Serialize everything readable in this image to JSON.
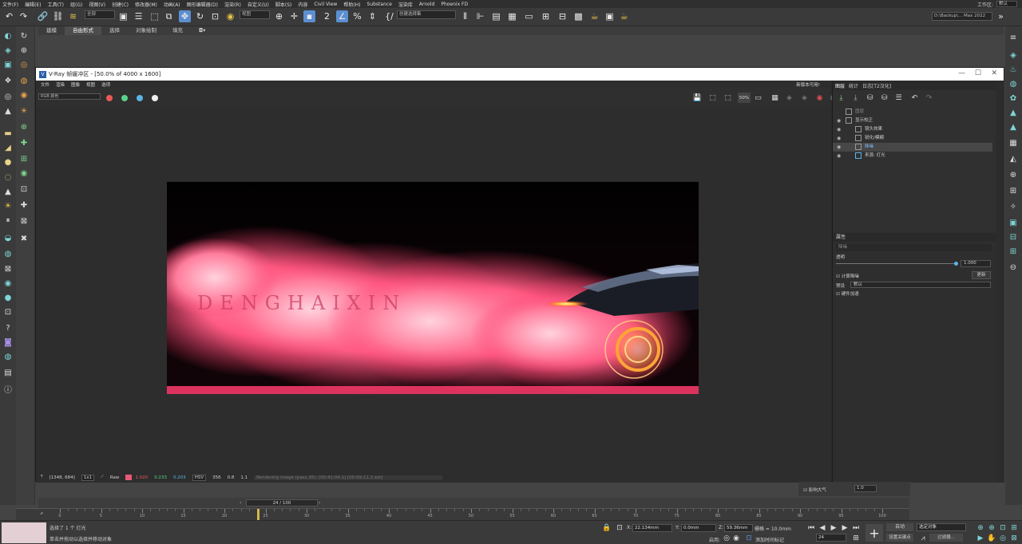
{
  "menubar": {
    "items": [
      "文件(F)",
      "编辑(E)",
      "工具(T)",
      "组(G)",
      "视图(V)",
      "创建(C)",
      "修改器(M)",
      "动画(A)",
      "图形编辑器(D)",
      "渲染(R)",
      "自定义(U)",
      "脚本(S)",
      "内容",
      "Civil View",
      "帮助(H)",
      "Substance",
      "渲染库",
      "Arnold",
      "Phoenix FD"
    ],
    "workspace_label": "工作区:",
    "workspace_value": "默认"
  },
  "toolbar": {
    "filter_value": "全部",
    "view_value": "视图",
    "selset_value": "创建选择集",
    "project_path": "D:\\Backup\\... Max 2022"
  },
  "ribbon": {
    "tabs": [
      "建模",
      "自由形式",
      "选择",
      "对象绘制",
      "填充"
    ],
    "active": "自由形式"
  },
  "vfb": {
    "title": "V-Ray 帧缓冲区 - [50.0% of 4000 x 1600]",
    "menu": [
      "文件",
      "渲染",
      "图像",
      "视图",
      "选项"
    ],
    "new_version": "新版本可用!",
    "channel": "RGB 颜色",
    "zoom_label": "50%",
    "render_text": "DENGHAIXIN",
    "status": {
      "coords": "[1348, 684]",
      "ratio": "1x1",
      "mode": "Raw",
      "r": "1.020",
      "g": "0.233",
      "b": "0.203",
      "space": "HSV",
      "h": "356",
      "s": "0.8",
      "v": "1.1",
      "log": "Rendering image (pass 26): [00:41:04.1] [00:09:11.2 est]"
    }
  },
  "panel": {
    "tabs": [
      "图层",
      "统计",
      "日志[T2汉化]"
    ],
    "layers": [
      {
        "label": "图层",
        "indent": 1
      },
      {
        "label": "显示校正",
        "indent": 1
      },
      {
        "label": "镜头效果",
        "indent": 2
      },
      {
        "label": "锐化/模糊",
        "indent": 2
      },
      {
        "label": "降噪",
        "indent": 2
      },
      {
        "label": "来源: 灯光",
        "indent": 2
      }
    ],
    "props_header": "属性",
    "props_name": "降噪",
    "opacity_label": "透明",
    "opacity_value": "1.000",
    "calc_label": "计算降噪",
    "update_btn": "更新",
    "preset_label": "预设",
    "preset_value": "默认",
    "hw_label": "硬件加速"
  },
  "cmdpanel": {
    "row1": "影响大气",
    "row1_value": "1.0"
  },
  "timeline": {
    "frame": "24 / 100",
    "ticks": [
      "0",
      "5",
      "10",
      "15",
      "20",
      "25",
      "30",
      "35",
      "40",
      "45",
      "50",
      "55",
      "60",
      "65",
      "70",
      "75",
      "80",
      "85",
      "90",
      "95",
      "100"
    ],
    "current": 24
  },
  "status": {
    "line1": "选择了 1 个 灯光",
    "line2": "单击并拖动以选择并移动对象",
    "x": "22.134mm",
    "y": "0.0mm",
    "z": "59.36mm",
    "grid": "栅格 = 10.0mm",
    "enable": "启用:",
    "add_tag": "添加时间标记",
    "auto": "自动",
    "sel_obj": "选定对象",
    "set_key": "设置关键点",
    "filter": "过滤器...",
    "frame_field": "24"
  },
  "colors": {
    "accent": "#5b8fd1",
    "smoke": "#ff4b7a",
    "wheel": "#ffb23a"
  }
}
